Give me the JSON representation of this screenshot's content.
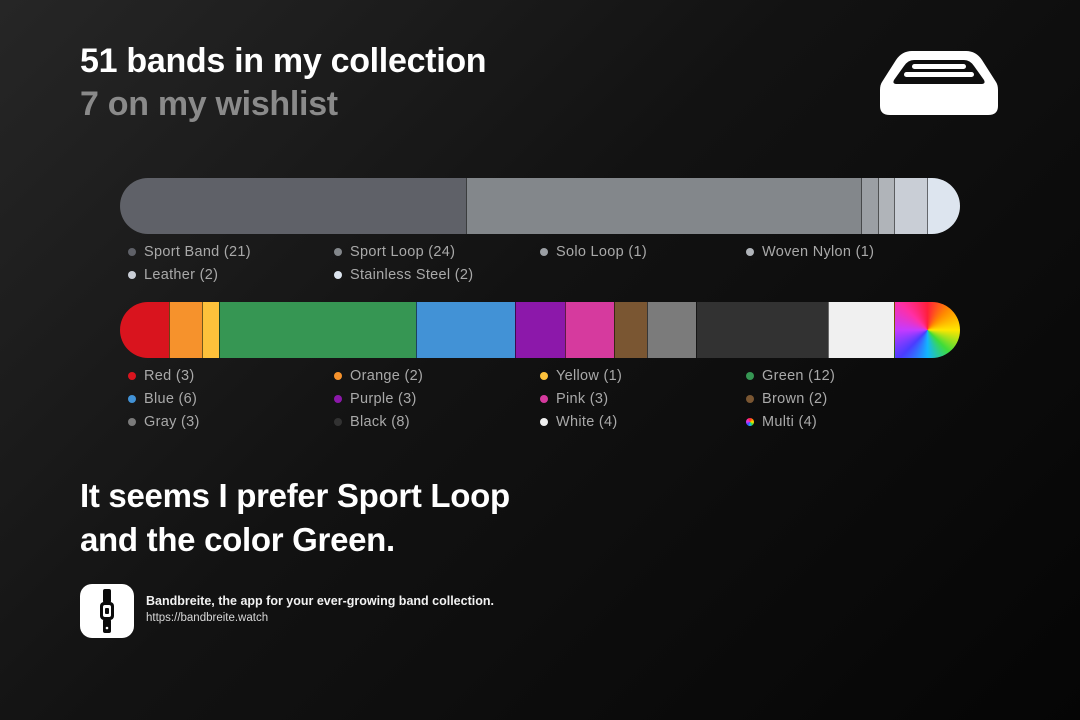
{
  "header": {
    "title": "51 bands in my collection",
    "subtitle": "7 on my wishlist",
    "icon": "band-tray-icon"
  },
  "chart_data": [
    {
      "type": "bar",
      "stacked": true,
      "orientation": "horizontal",
      "categories": [
        "Sport Band",
        "Sport Loop",
        "Solo Loop",
        "Woven Nylon",
        "Leather",
        "Stainless Steel"
      ],
      "values": [
        21,
        24,
        1,
        1,
        2,
        2
      ],
      "colors": [
        "#5f6168",
        "#83878b",
        "#9b9fa4",
        "#b0b4b9",
        "#c9ced6",
        "#dde5ef"
      ],
      "legend_labels": [
        "Sport Band (21)",
        "Sport Loop (24)",
        "Solo Loop (1)",
        "Woven Nylon (1)",
        "Leather (2)",
        "Stainless Steel (2)"
      ],
      "legend_position": "bottom"
    },
    {
      "type": "bar",
      "stacked": true,
      "orientation": "horizontal",
      "categories": [
        "Red",
        "Orange",
        "Yellow",
        "Green",
        "Blue",
        "Purple",
        "Pink",
        "Brown",
        "Gray",
        "Black",
        "White",
        "Multi"
      ],
      "values": [
        3,
        2,
        1,
        12,
        6,
        3,
        3,
        2,
        3,
        8,
        4,
        4
      ],
      "colors": [
        "#d9141e",
        "#f6922c",
        "#fdc13b",
        "#369653",
        "#4292d6",
        "#8c18aa",
        "#d63a9e",
        "#7a5632",
        "#7b7b7b",
        "#323232",
        "#f0f0f0",
        "multi"
      ],
      "legend_labels": [
        "Red (3)",
        "Orange (2)",
        "Yellow (1)",
        "Green (12)",
        "Blue (6)",
        "Purple (3)",
        "Pink (3)",
        "Brown (2)",
        "Gray (3)",
        "Black (8)",
        "White (4)",
        "Multi (4)"
      ],
      "legend_position": "bottom"
    }
  ],
  "conclusion": {
    "line1": "It seems I prefer Sport Loop",
    "line2": "and the color Green."
  },
  "footer": {
    "icon": "watch-band-app-icon",
    "tagline": "Bandbreite, the app for your ever-growing band collection.",
    "url": "https://bandbreite.watch"
  }
}
